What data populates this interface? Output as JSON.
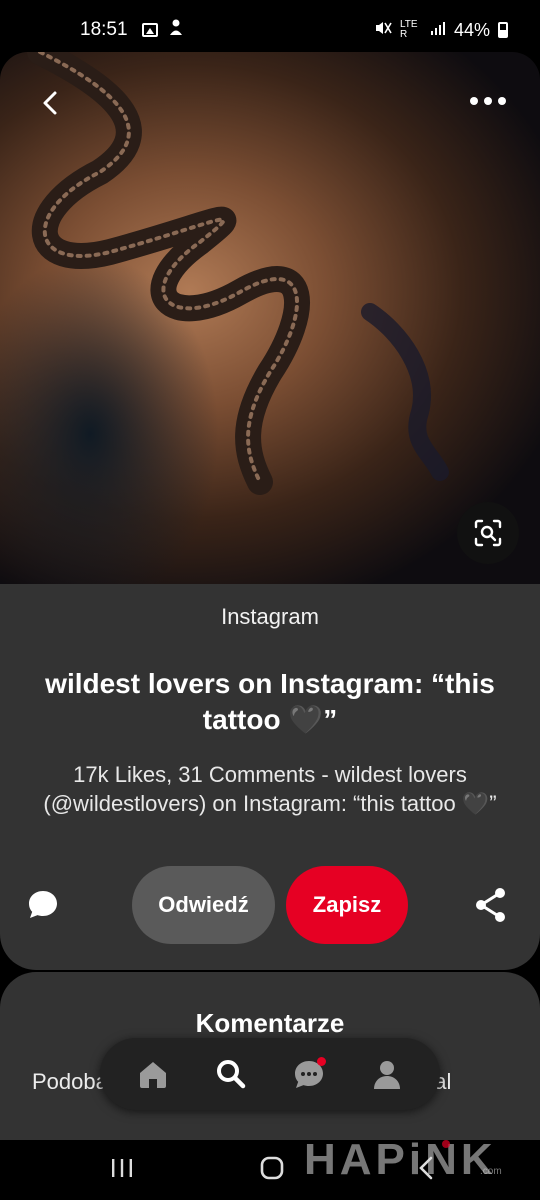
{
  "status_bar": {
    "time": "18:51",
    "network": "LTE R",
    "battery": "44%"
  },
  "pin": {
    "source": "Instagram",
    "title": "wildest lovers on Instagram: “this tattoo 🖤”",
    "description": "17k Likes, 31 Comments - wildest lovers (@wildestlovers) on Instagram: “this tattoo 🖤”"
  },
  "actions": {
    "visit_label": "Odwiedź",
    "save_label": "Zapisz"
  },
  "comments": {
    "heading": "Komentarze",
    "text": "Podoba się użytkownikowi Christian Bernal"
  },
  "bottom_nav": {
    "items": [
      "home-icon",
      "search-icon",
      "messages-icon",
      "profile-icon"
    ],
    "notification_on": "messages-icon"
  },
  "watermark": {
    "text": "HAPiNK",
    "suffix": ".com"
  },
  "colors": {
    "accent": "#e60023",
    "card": "#333333",
    "visit_button": "#5a5a5a"
  }
}
